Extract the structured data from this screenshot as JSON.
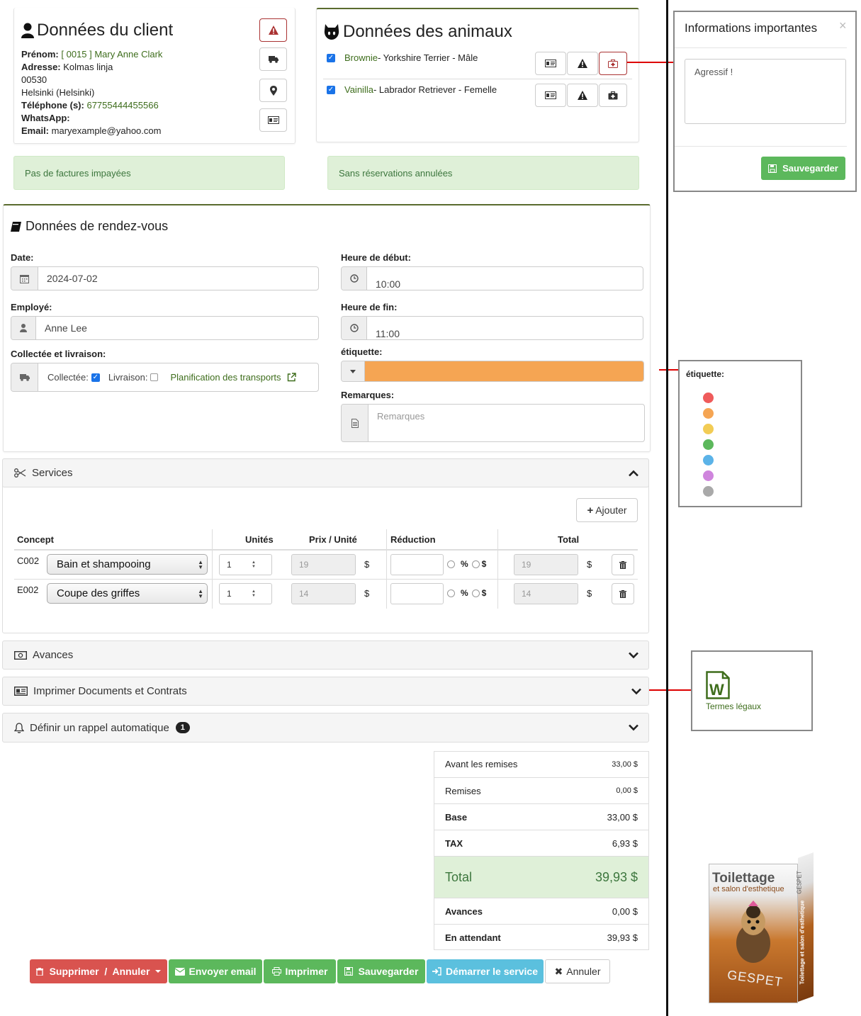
{
  "client": {
    "title": "Données du client",
    "prenom_label": "Prénom:",
    "prenom_value": "[ 0015 ] Mary Anne Clark",
    "adresse_label": "Adresse:",
    "adresse_value": "Kolmas linja",
    "postal": "00530",
    "city": "Helsinki (Helsinki)",
    "tel_label": "Téléphone (s):",
    "tel_value": "67755444455566",
    "whatsapp_label": "WhatsApp:",
    "email_label": "Email:",
    "email_value": "maryexample@yahoo.com"
  },
  "animals": {
    "title": "Données des animaux",
    "items": [
      {
        "name": "Brownie",
        "details": " - Yorkshire Terrier - Mâle"
      },
      {
        "name": "Vainilla",
        "details": " - Labrador Retriever - Femelle"
      }
    ]
  },
  "alerts": {
    "unpaid": "Pas de factures impayées",
    "cancelled": "Sans réservations annulées"
  },
  "info": {
    "title": "Informations importantes",
    "close": "×",
    "text": "Agressif !",
    "save": "Sauvegarder"
  },
  "appointment": {
    "title": "Données de rendez-vous",
    "date_label": "Date:",
    "date_value": "2024-07-02",
    "start_label": "Heure de début:",
    "start_value": "10:00",
    "employee_label": "Employé:",
    "employee_value": "Anne Lee",
    "end_label": "Heure de fin:",
    "end_value": "11:00",
    "transport_label": "Collectée et livraison:",
    "collected_label": "Collectée:",
    "delivery_label": "Livraison:",
    "transport_link": "Planification des transports",
    "tag_label": "étiquette:",
    "tag_color": "#f5a553",
    "remarks_label": "Remarques:",
    "remarks_placeholder": "Remarques"
  },
  "tag_popup": {
    "title": "étiquette:",
    "colors": [
      "#ef5b5b",
      "#f5a553",
      "#f2cc55",
      "#5cb85c",
      "#5bb3e8",
      "#cf85dd",
      "#a9a9a9"
    ]
  },
  "services": {
    "title": "Services",
    "add": "Ajouter",
    "headers": {
      "concept": "Concept",
      "units": "Unités",
      "price": "Prix / Unité",
      "reduction": "Réduction",
      "total": "Total"
    },
    "currency": "$",
    "percent": "%",
    "rows": [
      {
        "code": "C002",
        "service": "Bain et shampooing",
        "units": "1",
        "price": "19",
        "total": "19"
      },
      {
        "code": "E002",
        "service": "Coupe des griffes",
        "units": "1",
        "price": "14",
        "total": "14"
      }
    ]
  },
  "sections": {
    "advances": "Avances",
    "print": "Imprimer Documents et Contrats",
    "reminder": "Définir un rappel automatique",
    "reminder_badge": "1"
  },
  "legal": {
    "label": "Termes légaux",
    "icon_letter": "W"
  },
  "summary": {
    "before_label": "Avant les remises",
    "before_value": "33,00 $",
    "discounts_label": "Remises",
    "discounts_value": "0,00 $",
    "base_label": "Base",
    "base_value": "33,00 $",
    "tax_label": "TAX",
    "tax_value": "6,93 $",
    "total_label": "Total",
    "total_value": "39,93 $",
    "advances_label": "Avances",
    "advances_value": "0,00 $",
    "pending_label": "En attendant",
    "pending_value": "39,93 $"
  },
  "buttons": {
    "delete": "Supprimer  /  Annuler",
    "email": "Envoyer email",
    "print": "Imprimer",
    "save": "Sauvegarder",
    "start": "Démarrer le service",
    "cancel": "Annuler"
  },
  "product": {
    "line1": "Toilettage",
    "line2": "et salon d'esthetique",
    "brand": "GESPET",
    "side": "Toilettage et salon d'esthetique",
    "side_brand": "GESPET"
  }
}
